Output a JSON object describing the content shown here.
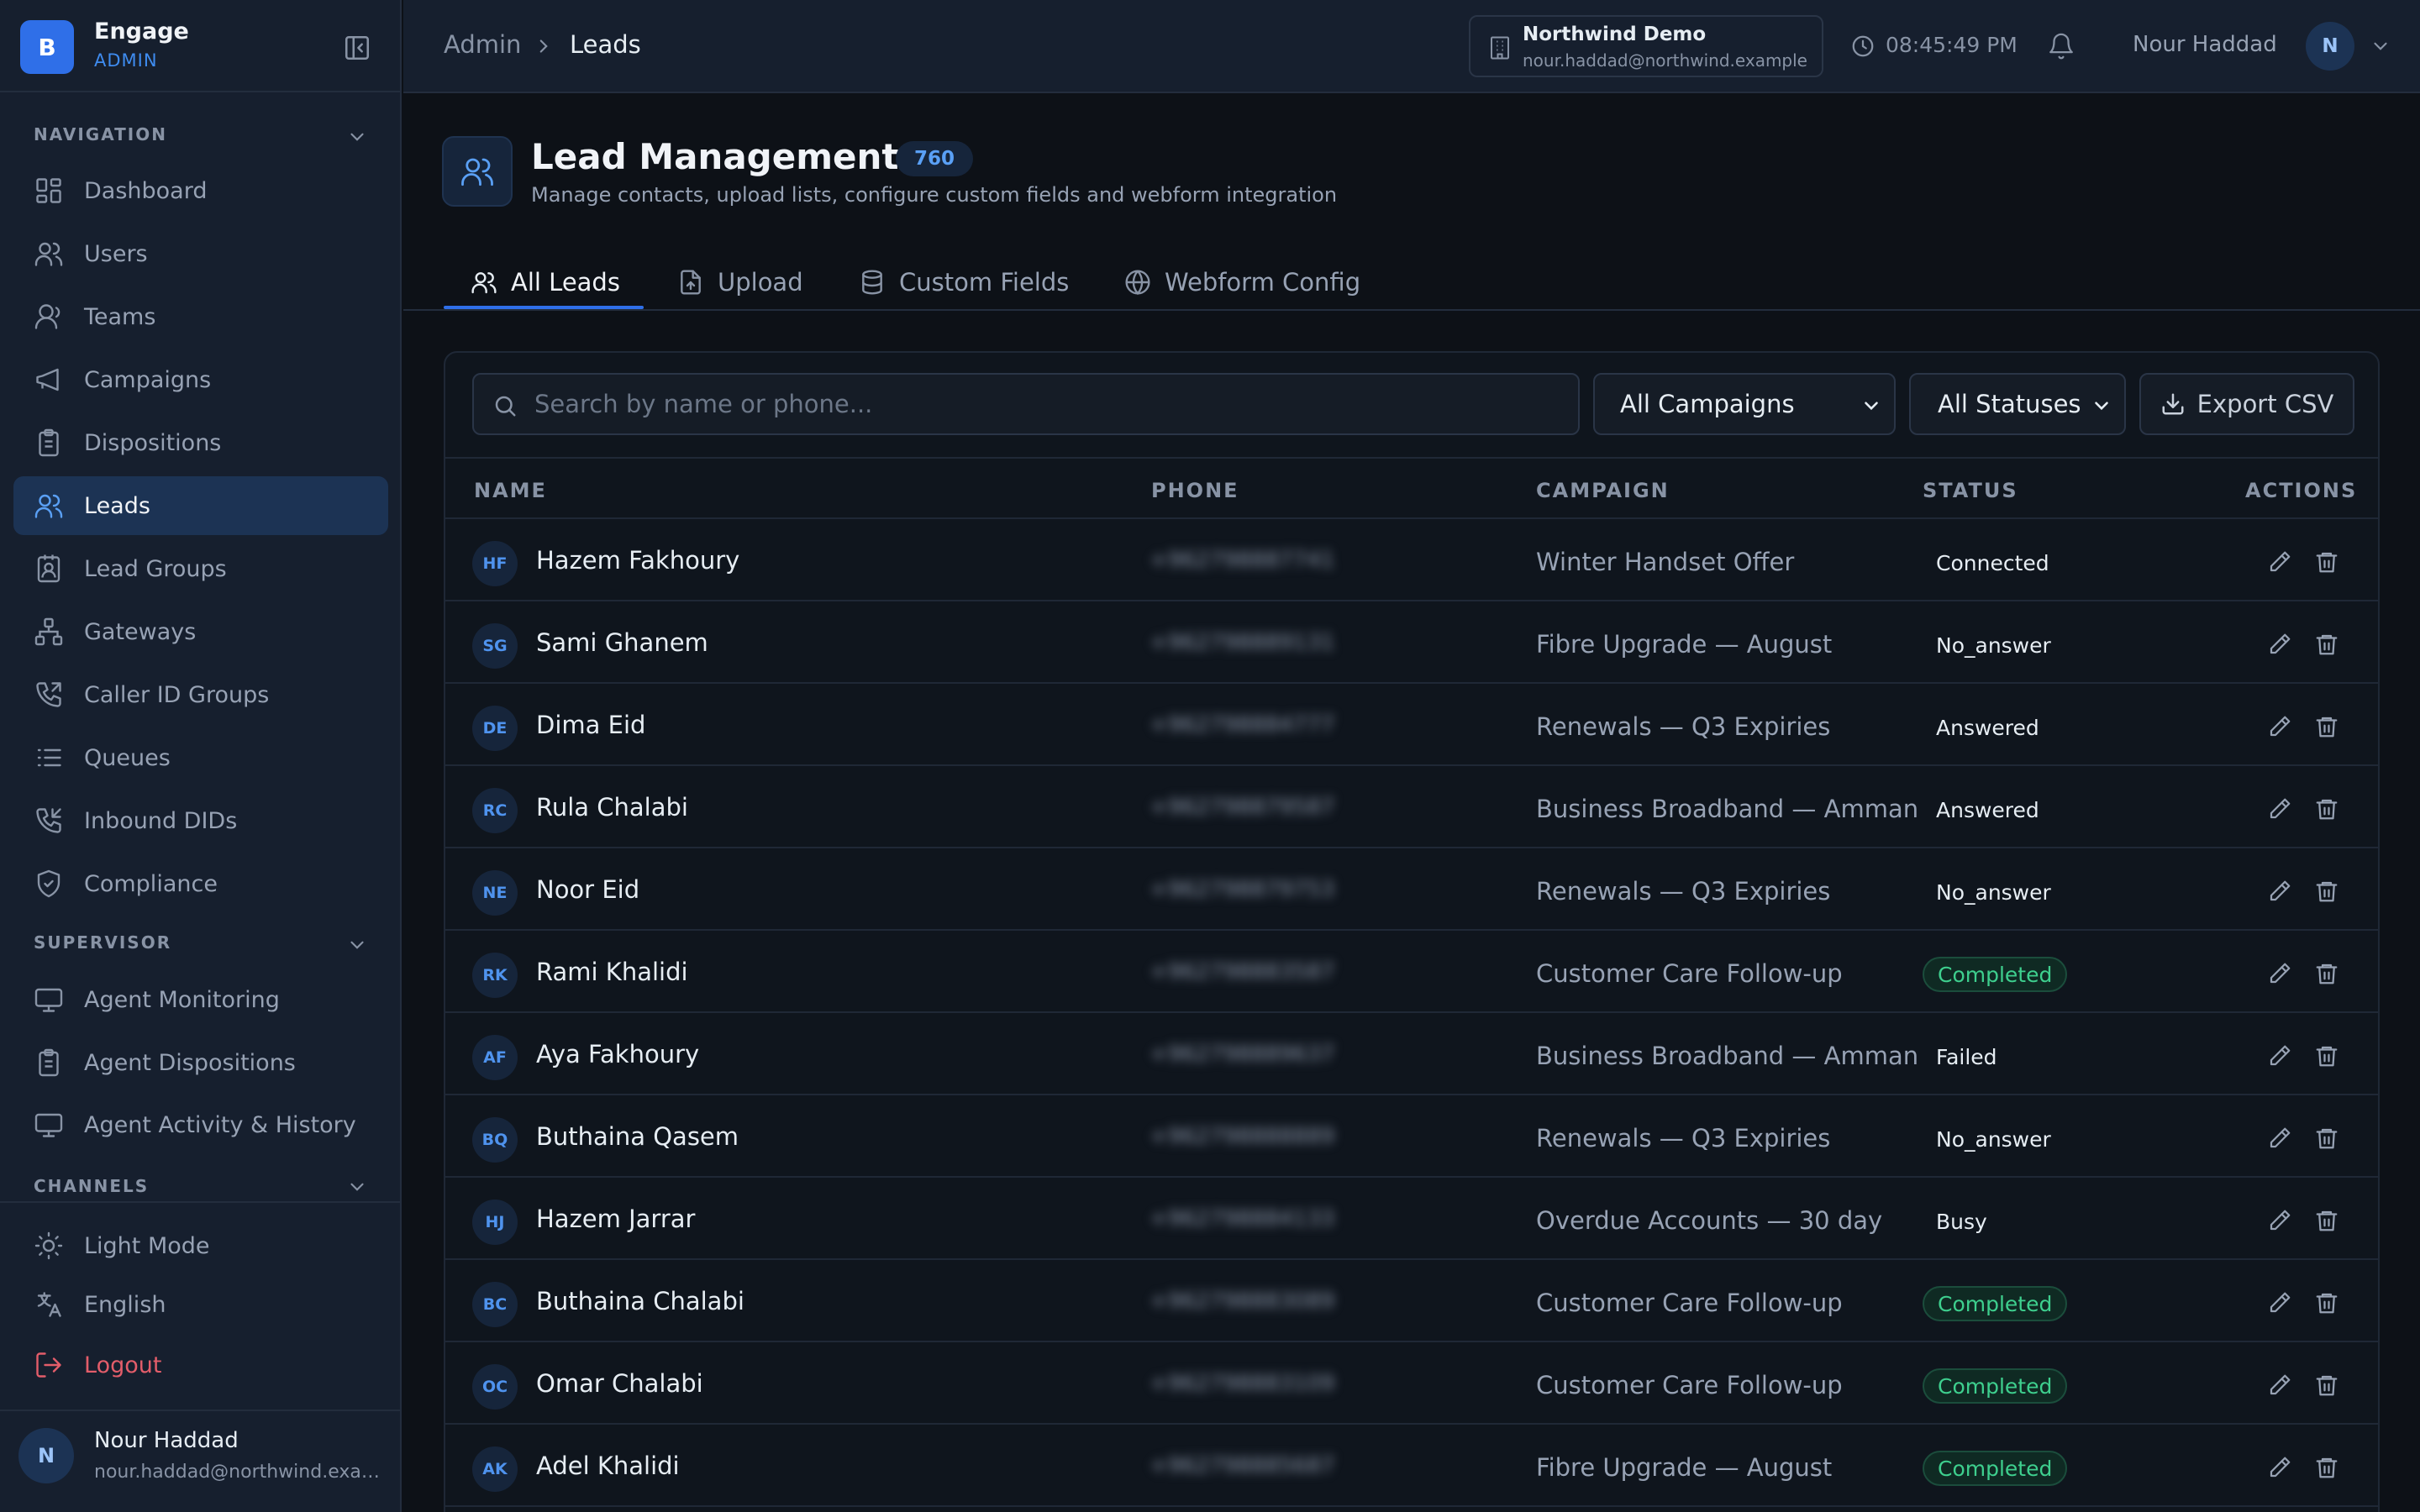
{
  "brand": {
    "logo_letter": "B",
    "name": "Engage",
    "role": "ADMIN"
  },
  "sidebar": {
    "navigation_label": "NAVIGATION",
    "supervisor_label": "SUPERVISOR",
    "channels_label": "CHANNELS",
    "nav_items": [
      {
        "label": "Dashboard",
        "icon": "dashboard-icon"
      },
      {
        "label": "Users",
        "icon": "users-icon"
      },
      {
        "label": "Teams",
        "icon": "teams-icon"
      },
      {
        "label": "Campaigns",
        "icon": "megaphone-icon"
      },
      {
        "label": "Dispositions",
        "icon": "clipboard-icon"
      },
      {
        "label": "Leads",
        "icon": "leads-icon",
        "active": true
      },
      {
        "label": "Lead Groups",
        "icon": "contact-book-icon"
      },
      {
        "label": "Gateways",
        "icon": "network-icon"
      },
      {
        "label": "Caller ID Groups",
        "icon": "phone-forward-icon"
      },
      {
        "label": "Queues",
        "icon": "list-icon"
      },
      {
        "label": "Inbound DIDs",
        "icon": "phone-incoming-icon"
      },
      {
        "label": "Compliance",
        "icon": "shield-check-icon"
      }
    ],
    "supervisor_items": [
      {
        "label": "Agent Monitoring",
        "icon": "monitor-icon"
      },
      {
        "label": "Agent Dispositions",
        "icon": "clipboard-icon"
      },
      {
        "label": "Agent Activity & History",
        "icon": "monitor-icon"
      }
    ],
    "footer": {
      "light_mode": "Light Mode",
      "language": "English",
      "logout": "Logout"
    },
    "user": {
      "initial": "N",
      "name": "Nour Haddad",
      "email": "nour.haddad@northwind.example"
    }
  },
  "topbar": {
    "breadcrumb": [
      "Admin",
      "Leads"
    ],
    "org_name": "Northwind Demo",
    "org_email": "nour.haddad@northwind.example",
    "time": "08:45:49 PM",
    "user_name": "Nour Haddad",
    "user_initial": "N"
  },
  "page": {
    "title": "Lead Management",
    "count": "760",
    "subtitle": "Manage contacts, upload lists, configure custom fields and webform integration",
    "tabs": [
      {
        "label": "All Leads",
        "icon": "users-icon",
        "active": true
      },
      {
        "label": "Upload",
        "icon": "file-upload-icon"
      },
      {
        "label": "Custom Fields",
        "icon": "database-icon"
      },
      {
        "label": "Webform Config",
        "icon": "globe-icon"
      }
    ]
  },
  "toolbar": {
    "search_placeholder": "Search by name or phone...",
    "campaign_filter": "All Campaigns",
    "status_filter": "All Statuses",
    "export_label": "Export CSV"
  },
  "table": {
    "columns": [
      "NAME",
      "PHONE",
      "CAMPAIGN",
      "STATUS",
      "ACTIONS"
    ],
    "rows": [
      {
        "initials": "HF",
        "name": "Hazem Fakhoury",
        "phone": "+962798887741",
        "campaign": "Winter Handset Offer",
        "status": "Connected"
      },
      {
        "initials": "SG",
        "name": "Sami Ghanem",
        "phone": "+962798889131",
        "campaign": "Fibre Upgrade — August",
        "status": "No_answer"
      },
      {
        "initials": "DE",
        "name": "Dima Eid",
        "phone": "+962798884777",
        "campaign": "Renewals — Q3 Expiries",
        "status": "Answered"
      },
      {
        "initials": "RC",
        "name": "Rula Chalabi",
        "phone": "+962798879587",
        "campaign": "Business Broadband — Amman",
        "status": "Answered"
      },
      {
        "initials": "NE",
        "name": "Noor Eid",
        "phone": "+962798879753",
        "campaign": "Renewals — Q3 Expiries",
        "status": "No_answer"
      },
      {
        "initials": "RK",
        "name": "Rami Khalidi",
        "phone": "+962798883587",
        "campaign": "Customer Care Follow-up",
        "status": "Completed"
      },
      {
        "initials": "AF",
        "name": "Aya Fakhoury",
        "phone": "+962798889637",
        "campaign": "Business Broadband — Amman",
        "status": "Failed"
      },
      {
        "initials": "BQ",
        "name": "Buthaina Qasem",
        "phone": "+962798888889",
        "campaign": "Renewals — Q3 Expiries",
        "status": "No_answer"
      },
      {
        "initials": "HJ",
        "name": "Hazem Jarrar",
        "phone": "+962798884133",
        "campaign": "Overdue Accounts — 30 day",
        "status": "Busy"
      },
      {
        "initials": "BC",
        "name": "Buthaina Chalabi",
        "phone": "+962798883089",
        "campaign": "Customer Care Follow-up",
        "status": "Completed"
      },
      {
        "initials": "OC",
        "name": "Omar Chalabi",
        "phone": "+962798883109",
        "campaign": "Customer Care Follow-up",
        "status": "Completed"
      },
      {
        "initials": "AK",
        "name": "Adel Khalidi",
        "phone": "+962798885687",
        "campaign": "Fibre Upgrade — August",
        "status": "Completed"
      }
    ]
  },
  "colors": {
    "accent": "#2f6fe8",
    "success": "#3ecf8e",
    "danger": "#e35d6a",
    "background": "#0d1117",
    "sidebar": "#161f2e"
  }
}
